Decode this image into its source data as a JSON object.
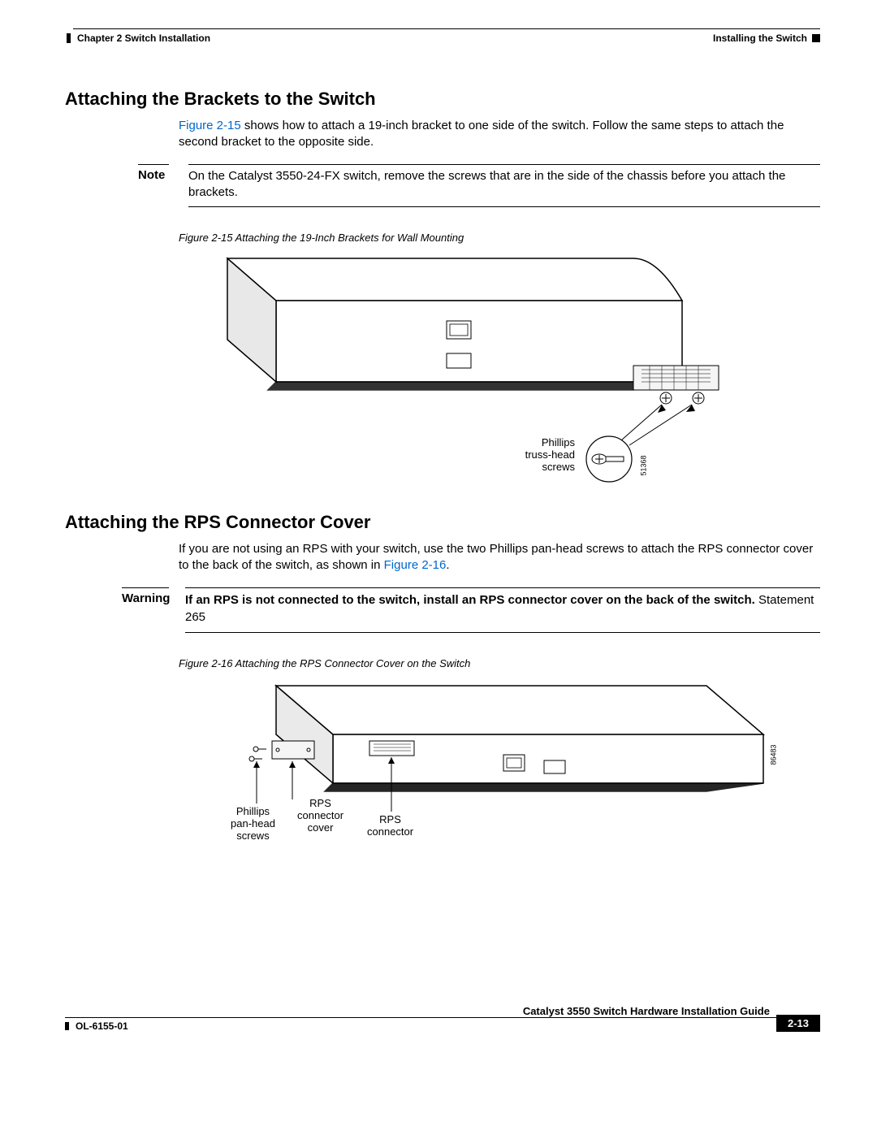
{
  "header": {
    "chapter": "Chapter 2      Switch Installation",
    "section_right": "Installing the Switch"
  },
  "section1": {
    "title": "Attaching the Brackets to the Switch",
    "para_link": "Figure 2-15",
    "para_after": " shows how to attach a 19-inch bracket to one side of the switch. Follow the same steps to attach the second bracket to the opposite side.",
    "note_label": "Note",
    "note_text": "On the Catalyst 3550-24-FX switch, remove the screws that are in the side of the chassis before you attach the brackets.",
    "fig_caption": "Figure 2-15   Attaching the 19-Inch Brackets for Wall Mounting",
    "fig_anno": "Phillips\ntruss-head\nscrews",
    "fig_id": "51368"
  },
  "section2": {
    "title": "Attaching the RPS Connector Cover",
    "para_before": "If you are not using an RPS with your switch, use the two Phillips pan-head screws to attach the RPS connector cover to the back of the switch, as shown in ",
    "para_link": "Figure 2-16",
    "para_after": ".",
    "warn_label": "Warning",
    "warn_bold": "If an RPS is not connected to the switch, install an RPS connector cover on the back of the switch.",
    "warn_stmt": "Statement 265",
    "fig_caption": "Figure 2-16   Attaching the RPS Connector Cover on the Switch",
    "anno_screws": "Phillips\npan-head\nscrews",
    "anno_cover": "RPS\nconnector\ncover",
    "anno_conn": "RPS\nconnector",
    "fig_id": "86483"
  },
  "footer": {
    "doc_title": "Catalyst 3550 Switch Hardware Installation Guide",
    "doc_num": "OL-6155-01",
    "page": "2-13"
  }
}
